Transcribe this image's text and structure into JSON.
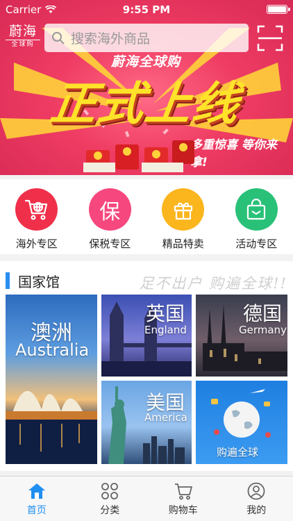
{
  "status_bar": {
    "carrier": "Carrier",
    "time": "9:55 PM"
  },
  "header": {
    "logo_top": "蔚海",
    "logo_bottom": "全球购",
    "search_placeholder": "搜索海外商品"
  },
  "banner": {
    "brand": "蔚海全球购",
    "title": "正式上线",
    "subtitle": "多重惊喜 等你来拿!",
    "envelope_amounts": [
      "1000",
      "5000",
      "3000"
    ]
  },
  "categories": [
    {
      "label": "海外专区",
      "icon": "cart-globe-icon",
      "color": "#f0304a"
    },
    {
      "label": "保税专区",
      "icon": "bonded-icon",
      "glyph": "保",
      "color": "#f6477e"
    },
    {
      "label": "精品特卖",
      "icon": "gift-icon",
      "color": "#fbb51d"
    },
    {
      "label": "活动专区",
      "icon": "bag-icon",
      "color": "#29c178"
    }
  ],
  "country_section": {
    "title": "国家馆",
    "slogan": "足不出户 购遍全球!!",
    "tiles": [
      {
        "cn": "澳洲",
        "en": "Australia"
      },
      {
        "cn": "英国",
        "en": "England"
      },
      {
        "cn": "德国",
        "en": "Germany"
      },
      {
        "cn": "美国",
        "en": "America"
      },
      {
        "cn": "购遍全球",
        "en": ""
      }
    ]
  },
  "tabbar": {
    "items": [
      {
        "label": "首页",
        "icon": "home-icon",
        "active": true
      },
      {
        "label": "分类",
        "icon": "category-icon",
        "active": false
      },
      {
        "label": "购物车",
        "icon": "cart-icon",
        "active": false
      },
      {
        "label": "我的",
        "icon": "user-icon",
        "active": false
      }
    ],
    "active_color": "#1f8ff2"
  }
}
